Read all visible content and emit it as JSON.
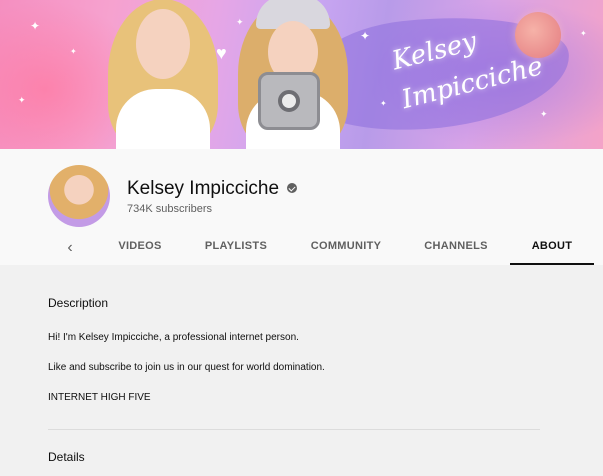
{
  "banner": {
    "signature": "Kelsey Impicciche"
  },
  "channel": {
    "name": "Kelsey Impicciche",
    "subscribers": "734K subscribers"
  },
  "tabs": {
    "back_icon": "‹",
    "items": [
      {
        "label": "VIDEOS"
      },
      {
        "label": "PLAYLISTS"
      },
      {
        "label": "COMMUNITY"
      },
      {
        "label": "CHANNELS"
      },
      {
        "label": "ABOUT",
        "active": true
      }
    ]
  },
  "about": {
    "description_title": "Description",
    "description_lines": [
      "Hi! I'm Kelsey Impicciche, a professional internet person.",
      "Like and subscribe to join us in our quest for world domination.",
      "INTERNET HIGH FIVE"
    ],
    "details_title": "Details"
  },
  "colors": {
    "accent_text": "#0f0f0f",
    "secondary_text": "#606060",
    "header_bg": "#f9f9f9",
    "content_bg": "#f1f1f1"
  }
}
